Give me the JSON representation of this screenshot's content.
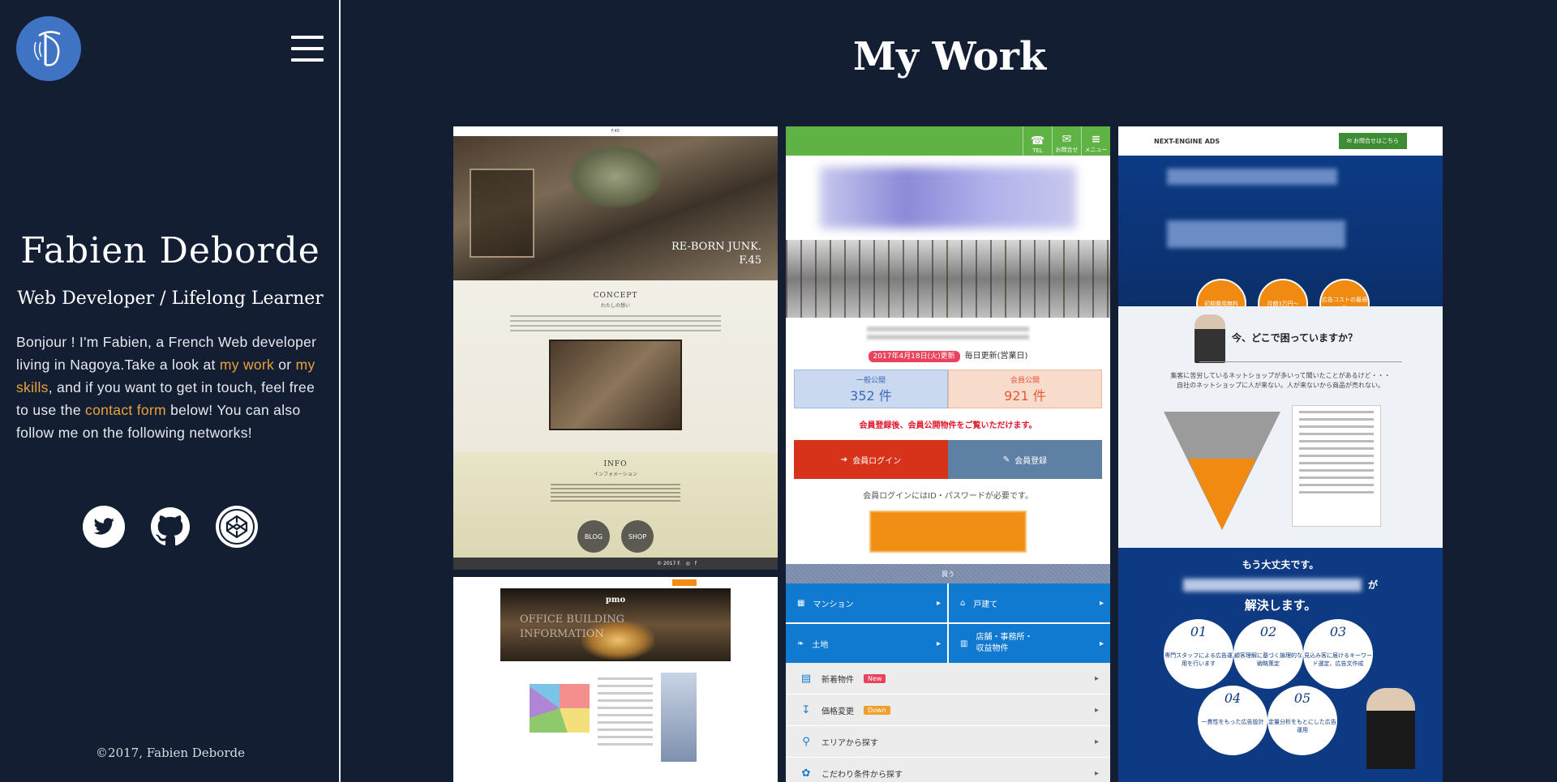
{
  "sidebar": {
    "logo_alt": "FD logo",
    "name": "Fabien Deborde",
    "tagline": "Web Developer / Lifelong Learner",
    "bio": {
      "intro": "Bonjour ! I'm Fabien, a French Web developer living in Nagoya.Take a look at ",
      "link_work": "my work",
      "or": " or ",
      "link_skills": "my skills",
      "middle": ", and if you want to get in touch, feel free to use the ",
      "link_contact": "contact form",
      "outro": " below! You can also follow me on the following networks!"
    },
    "social": [
      {
        "icon": "twitter-icon"
      },
      {
        "icon": "github-icon"
      },
      {
        "icon": "codepen-icon"
      }
    ],
    "copyright": "©2017, Fabien Deborde"
  },
  "main": {
    "title": "My Work",
    "projects": {
      "junk": {
        "brand": "F.45",
        "sign_line1": "RE-BORN JUNK.",
        "sign_line2": "F.45",
        "concept_title": "CONCEPT",
        "concept_sub": "わたしの想い",
        "info_title": "INFO",
        "info_sub": "インフォメーション",
        "btn_blog": "BLOG",
        "btn_shop": "SHOP",
        "footer": "© 2017 F."
      },
      "realestate": {
        "nav": [
          {
            "icon": "☎",
            "label": "TEL"
          },
          {
            "icon": "✉",
            "label": "お問合せ"
          },
          {
            "icon": "≡",
            "label": "メニュー"
          }
        ],
        "update_date": "2017年4月18日(火)更新",
        "update_note": "毎日更新(営業日)",
        "count_general_label": "一般公開",
        "count_general_value": "352 件",
        "count_member_label": "会員公開",
        "count_member_value": "921 件",
        "member_msg": "会員登録後、会員公開物件をご覧いただけます。",
        "login_label": "会員ログイン",
        "register_label": "会員登録",
        "login_note": "会員ログインにはID・パスワードが必要です。",
        "buy_label": "買う",
        "tiles": [
          {
            "label": "マンション",
            "icon": "▦"
          },
          {
            "label": "戸建て",
            "icon": "⌂"
          },
          {
            "label": "土地",
            "icon": "❧"
          },
          {
            "label": "店舗・事務所・収益物件",
            "icon": "▥"
          }
        ],
        "rows": [
          {
            "label": "新着物件",
            "icon": "▤",
            "tag": "New",
            "tag_color": "#e9425c"
          },
          {
            "label": "価格変更",
            "icon": "↧",
            "tag": "Down",
            "tag_color": "#f0a02a"
          },
          {
            "label": "エリアから探す",
            "icon": "⚲",
            "tag": "",
            "tag_color": ""
          },
          {
            "label": "こだわり条件から探す",
            "icon": "✿",
            "tag": "",
            "tag_color": ""
          }
        ]
      },
      "ads": {
        "brand": "NEXT-ENGINE ADS",
        "contact_btn": "お問合せはこちら",
        "circles": [
          "初期費用無料",
          "月額3万円〜",
          "広告コストの最適化"
        ],
        "question": "今、どこで困っていますか？",
        "text_line1": "集客に苦労しているネットショップが多いって聞いたことがあるけど・・・",
        "text_line2": "自社のネットショップに人が来ない。人が来ないから商品が売れない。",
        "line_ok": "もう大丈夫です。",
        "line_ga": "が",
        "line_solve": "解決します。",
        "steps": [
          {
            "num": "01",
            "text": "専門スタッフによる広告運用を行います"
          },
          {
            "num": "02",
            "text": "顧客理解に基づく論理的な戦略策定"
          },
          {
            "num": "03",
            "text": "見込み客に届けるキーワード選定、広告文作成"
          },
          {
            "num": "04",
            "text": "一貫性をもった広告設計"
          },
          {
            "num": "05",
            "text": "定量分析をもとにした広告運用"
          }
        ]
      },
      "office": {
        "brand": "pmo",
        "hero_line1": "OFFICE BUILDING",
        "hero_line2": "INFORMATION"
      }
    }
  }
}
